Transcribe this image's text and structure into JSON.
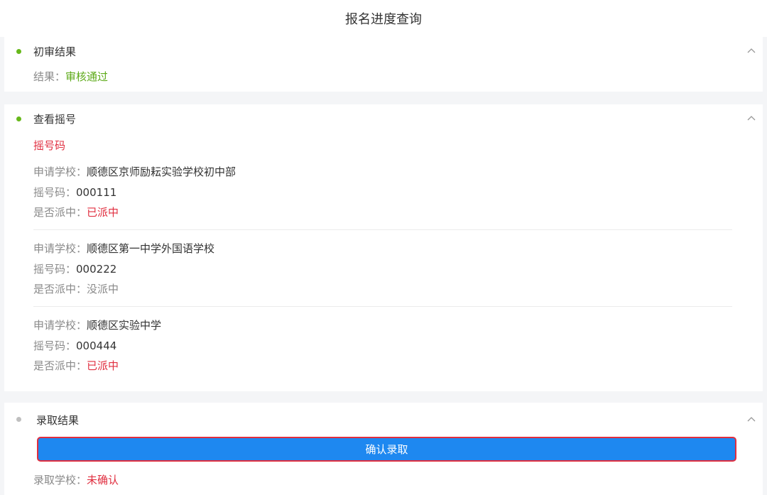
{
  "header": {
    "title": "报名进度查询"
  },
  "sections": [
    {
      "title": "初审结果",
      "result_label": "结果：",
      "result_value": "审核通过"
    },
    {
      "title": "查看摇号",
      "subtitle": "摇号码",
      "entries": [
        {
          "school_label": "申请学校：",
          "school": "顺德区京师励耘实验学校初中部",
          "code_label": "摇号码：",
          "code": "000111",
          "assigned_label": "是否派中：",
          "assigned": "已派中"
        },
        {
          "school_label": "申请学校：",
          "school": "顺德区第一中学外国语学校",
          "code_label": "摇号码：",
          "code": "000222",
          "assigned_label": "是否派中：",
          "assigned": "没派中"
        },
        {
          "school_label": "申请学校：",
          "school": "顺德区实验中学",
          "code_label": "摇号码：",
          "code": "000444",
          "assigned_label": "是否派中：",
          "assigned": "已派中"
        }
      ]
    },
    {
      "title": "录取结果",
      "button_label": "确认录取",
      "school_label": "录取学校：",
      "school_value": "未确认"
    }
  ],
  "colors": {
    "accent_blue": "#1e88f0",
    "success_green": "#5daa18",
    "alert_red": "#e02e3f"
  },
  "icons": {
    "collapse": "chevron-up-icon",
    "status": "dot-icon"
  }
}
